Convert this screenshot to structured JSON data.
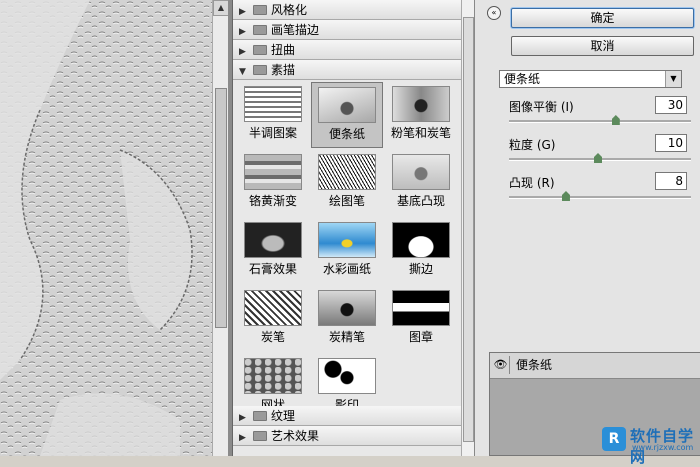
{
  "filter_list": {
    "categories_top": [
      "风格化",
      "画笔描边",
      "扭曲",
      "素描"
    ],
    "sketch_filters": [
      {
        "label": "半调图案"
      },
      {
        "label": "便条纸",
        "selected": true
      },
      {
        "label": "粉笔和炭笔"
      },
      {
        "label": "铬黄渐变"
      },
      {
        "label": "绘图笔"
      },
      {
        "label": "基底凸现"
      },
      {
        "label": "石膏效果"
      },
      {
        "label": "水彩画纸"
      },
      {
        "label": "撕边"
      },
      {
        "label": "炭笔"
      },
      {
        "label": "炭精笔"
      },
      {
        "label": "图章"
      },
      {
        "label": "网状"
      },
      {
        "label": "影印"
      }
    ],
    "categories_bottom": [
      "纹理",
      "艺术效果"
    ]
  },
  "settings": {
    "ok_label": "确定",
    "cancel_label": "取消",
    "selected_filter": "便条纸",
    "params": [
      {
        "label": "图像平衡 (I)",
        "value": "30",
        "fraction": 0.6
      },
      {
        "label": "粒度 (G)",
        "value": "10",
        "fraction": 0.5
      },
      {
        "label": "凸现 (R)",
        "value": "8",
        "fraction": 0.32
      }
    ],
    "layer_name": "便条纸"
  },
  "watermark": {
    "mark": "R",
    "text": "软件自学网",
    "url": "www.rjzxw.com"
  },
  "colors": {
    "accent": "#3b6ea5",
    "panel": "#e4e4e4",
    "watermark": "#1e6fb8"
  }
}
